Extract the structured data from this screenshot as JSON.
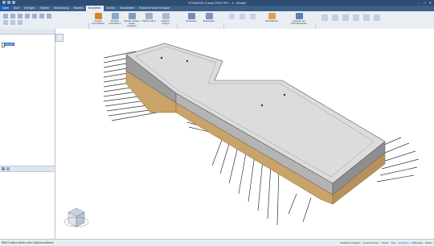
{
  "app": {
    "title": "STRAKON Cubus 2020 SP1 - 4 - Modell"
  },
  "tabs": [
    {
      "label": "Datei"
    },
    {
      "label": "Start"
    },
    {
      "label": "Einfügen"
    },
    {
      "label": "Objekte"
    },
    {
      "label": "Bearbeitung"
    },
    {
      "label": "Bauteile"
    },
    {
      "label": "Bearbeiten"
    },
    {
      "label": "Ansicht"
    },
    {
      "label": "Schalbreiter"
    },
    {
      "label": "Brücken/Tunnel Designer"
    }
  ],
  "ribbon": {
    "groups": [
      {
        "label": "Transformieren"
      },
      {
        "label": "Modellieren"
      },
      {
        "label": "Wände"
      },
      {
        "label": "Ändern"
      },
      {
        "label": "Boolesche Operationen"
      }
    ],
    "buttons": [
      {
        "label": "Punkte verschieben"
      },
      {
        "label": "Flächen extrudieren"
      },
      {
        "label": "Fläche entlang Kante schieben"
      },
      {
        "label": "Fläche teilen"
      },
      {
        "label": "Flächen neigen"
      },
      {
        "label": "Verbinden"
      },
      {
        "label": "Bearbeiten"
      },
      {
        "label": "Stirnflächen"
      },
      {
        "label": "Löschen am Schnittpunkten"
      }
    ]
  },
  "tree": {
    "root_label": "Modell"
  },
  "status": {
    "message": "Bitte Funktion wählen oder Objekte markieren",
    "right_items": [
      "Selektierte Objekte",
      "Ansicht Kanten",
      "Planar",
      "Fixe",
      "Aufteilung",
      "Griffpunkte",
      "Raster"
    ]
  },
  "colors": {
    "titlebar": "#2e4d73",
    "tabs": "#3d5f88",
    "accent": "#1e5fb3",
    "slab": "#dcdcdc",
    "timber": "#c9a36a"
  }
}
